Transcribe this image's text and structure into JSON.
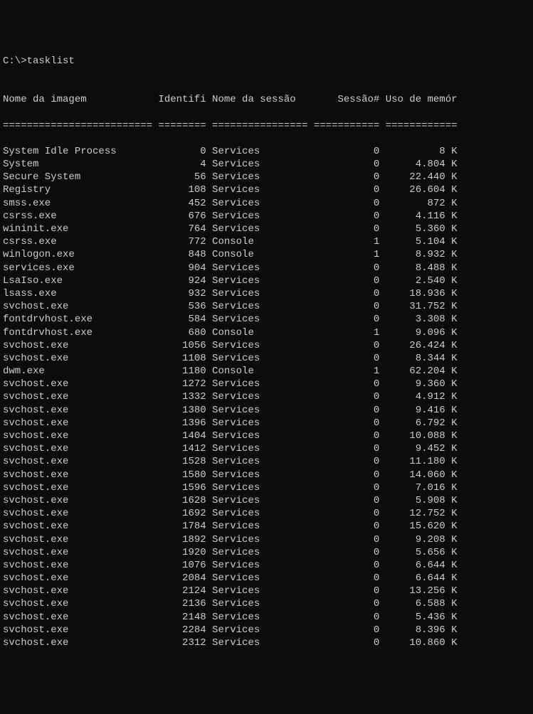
{
  "prompt": "C:\\>tasklist",
  "headers": {
    "image_name": "Nome da imagem",
    "pid": "Identifi",
    "session_name": "Nome da sessão",
    "session_num": "Sessão#",
    "mem_usage": "Uso de memór"
  },
  "separator": "========================= ======== ================ =========== ============",
  "processes": [
    {
      "name": "System Idle Process",
      "pid": "0",
      "session": "Services",
      "snum": "0",
      "mem": "8 K"
    },
    {
      "name": "System",
      "pid": "4",
      "session": "Services",
      "snum": "0",
      "mem": "4.804 K"
    },
    {
      "name": "Secure System",
      "pid": "56",
      "session": "Services",
      "snum": "0",
      "mem": "22.440 K"
    },
    {
      "name": "Registry",
      "pid": "108",
      "session": "Services",
      "snum": "0",
      "mem": "26.604 K"
    },
    {
      "name": "smss.exe",
      "pid": "452",
      "session": "Services",
      "snum": "0",
      "mem": "872 K"
    },
    {
      "name": "csrss.exe",
      "pid": "676",
      "session": "Services",
      "snum": "0",
      "mem": "4.116 K"
    },
    {
      "name": "wininit.exe",
      "pid": "764",
      "session": "Services",
      "snum": "0",
      "mem": "5.360 K"
    },
    {
      "name": "csrss.exe",
      "pid": "772",
      "session": "Console",
      "snum": "1",
      "mem": "5.104 K"
    },
    {
      "name": "winlogon.exe",
      "pid": "848",
      "session": "Console",
      "snum": "1",
      "mem": "8.932 K"
    },
    {
      "name": "services.exe",
      "pid": "904",
      "session": "Services",
      "snum": "0",
      "mem": "8.488 K"
    },
    {
      "name": "LsaIso.exe",
      "pid": "924",
      "session": "Services",
      "snum": "0",
      "mem": "2.540 K"
    },
    {
      "name": "lsass.exe",
      "pid": "932",
      "session": "Services",
      "snum": "0",
      "mem": "18.936 K"
    },
    {
      "name": "svchost.exe",
      "pid": "536",
      "session": "Services",
      "snum": "0",
      "mem": "31.752 K"
    },
    {
      "name": "fontdrvhost.exe",
      "pid": "584",
      "session": "Services",
      "snum": "0",
      "mem": "3.308 K"
    },
    {
      "name": "fontdrvhost.exe",
      "pid": "680",
      "session": "Console",
      "snum": "1",
      "mem": "9.096 K"
    },
    {
      "name": "svchost.exe",
      "pid": "1056",
      "session": "Services",
      "snum": "0",
      "mem": "26.424 K"
    },
    {
      "name": "svchost.exe",
      "pid": "1108",
      "session": "Services",
      "snum": "0",
      "mem": "8.344 K"
    },
    {
      "name": "dwm.exe",
      "pid": "1180",
      "session": "Console",
      "snum": "1",
      "mem": "62.204 K"
    },
    {
      "name": "svchost.exe",
      "pid": "1272",
      "session": "Services",
      "snum": "0",
      "mem": "9.360 K"
    },
    {
      "name": "svchost.exe",
      "pid": "1332",
      "session": "Services",
      "snum": "0",
      "mem": "4.912 K"
    },
    {
      "name": "svchost.exe",
      "pid": "1380",
      "session": "Services",
      "snum": "0",
      "mem": "9.416 K"
    },
    {
      "name": "svchost.exe",
      "pid": "1396",
      "session": "Services",
      "snum": "0",
      "mem": "6.792 K"
    },
    {
      "name": "svchost.exe",
      "pid": "1404",
      "session": "Services",
      "snum": "0",
      "mem": "10.088 K"
    },
    {
      "name": "svchost.exe",
      "pid": "1412",
      "session": "Services",
      "snum": "0",
      "mem": "9.452 K"
    },
    {
      "name": "svchost.exe",
      "pid": "1528",
      "session": "Services",
      "snum": "0",
      "mem": "11.180 K"
    },
    {
      "name": "svchost.exe",
      "pid": "1580",
      "session": "Services",
      "snum": "0",
      "mem": "14.060 K"
    },
    {
      "name": "svchost.exe",
      "pid": "1596",
      "session": "Services",
      "snum": "0",
      "mem": "7.016 K"
    },
    {
      "name": "svchost.exe",
      "pid": "1628",
      "session": "Services",
      "snum": "0",
      "mem": "5.908 K"
    },
    {
      "name": "svchost.exe",
      "pid": "1692",
      "session": "Services",
      "snum": "0",
      "mem": "12.752 K"
    },
    {
      "name": "svchost.exe",
      "pid": "1784",
      "session": "Services",
      "snum": "0",
      "mem": "15.620 K"
    },
    {
      "name": "svchost.exe",
      "pid": "1892",
      "session": "Services",
      "snum": "0",
      "mem": "9.208 K"
    },
    {
      "name": "svchost.exe",
      "pid": "1920",
      "session": "Services",
      "snum": "0",
      "mem": "5.656 K"
    },
    {
      "name": "svchost.exe",
      "pid": "1076",
      "session": "Services",
      "snum": "0",
      "mem": "6.644 K"
    },
    {
      "name": "svchost.exe",
      "pid": "2084",
      "session": "Services",
      "snum": "0",
      "mem": "6.644 K"
    },
    {
      "name": "svchost.exe",
      "pid": "2124",
      "session": "Services",
      "snum": "0",
      "mem": "13.256 K"
    },
    {
      "name": "svchost.exe",
      "pid": "2136",
      "session": "Services",
      "snum": "0",
      "mem": "6.588 K"
    },
    {
      "name": "svchost.exe",
      "pid": "2148",
      "session": "Services",
      "snum": "0",
      "mem": "5.436 K"
    },
    {
      "name": "svchost.exe",
      "pid": "2284",
      "session": "Services",
      "snum": "0",
      "mem": "8.396 K"
    },
    {
      "name": "svchost.exe",
      "pid": "2312",
      "session": "Services",
      "snum": "0",
      "mem": "10.860 K"
    }
  ]
}
